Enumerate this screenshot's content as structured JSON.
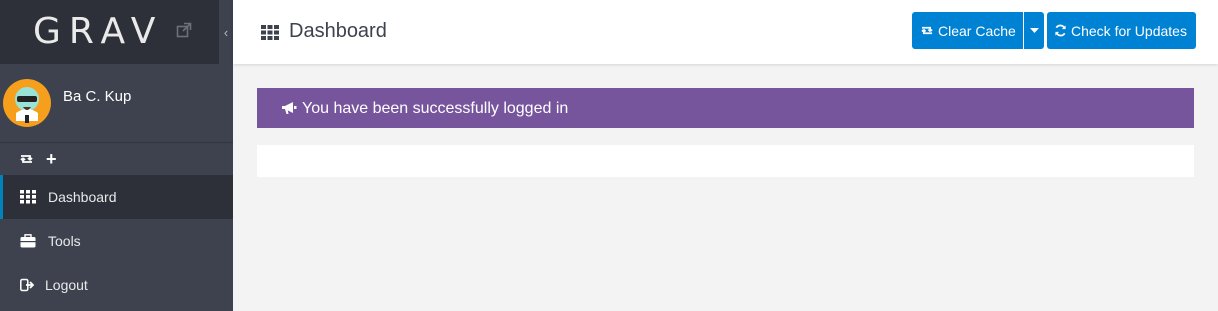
{
  "sidebar": {
    "logo": "GRAV",
    "collapse_glyph": "‹",
    "user": {
      "name": "Ba C. Kup"
    },
    "quick_actions": [
      {
        "icon": "retweet-icon",
        "glyph": "⇄"
      },
      {
        "icon": "plus-icon",
        "glyph": "+"
      }
    ],
    "items": [
      {
        "label": "Dashboard",
        "icon": "grid-icon",
        "active": true
      },
      {
        "label": "Tools",
        "icon": "briefcase-icon",
        "active": false
      },
      {
        "label": "Logout",
        "icon": "sign-out-icon",
        "active": false
      }
    ]
  },
  "header": {
    "title": "Dashboard",
    "clear_cache_label": "Clear Cache",
    "check_updates_label": "Check for Updates"
  },
  "alert": {
    "message": "You have been successfully logged in"
  },
  "colors": {
    "sidebar_bg": "#3d424e",
    "sidebar_dark": "#2d3039",
    "accent": "#0082d4",
    "alert_bg": "#77559d",
    "page_bg": "#f3f3f3"
  }
}
